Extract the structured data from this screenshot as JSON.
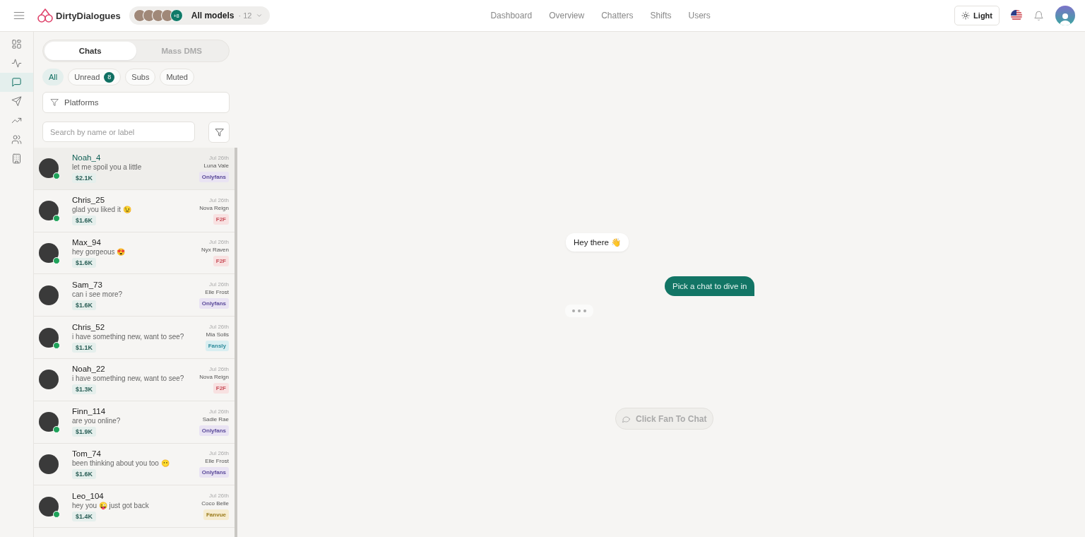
{
  "header": {
    "brand": "DirtyDialogues",
    "models": {
      "extra": "+8",
      "label": "All models",
      "count": "· 12"
    },
    "nav": [
      {
        "label": "Dashboard"
      },
      {
        "label": "Overview"
      },
      {
        "label": "Chatters"
      },
      {
        "label": "Shifts"
      },
      {
        "label": "Users"
      }
    ],
    "theme_button": "Light"
  },
  "sidebar": {
    "items": [
      {
        "kind": "grid",
        "selected": false
      },
      {
        "kind": "pulse",
        "selected": false
      },
      {
        "kind": "chat",
        "selected": true
      },
      {
        "kind": "send",
        "selected": false
      },
      {
        "kind": "trend",
        "selected": false
      },
      {
        "kind": "users",
        "selected": false
      },
      {
        "kind": "building",
        "selected": false
      }
    ]
  },
  "tabs": [
    {
      "label": "Chats",
      "selected": true
    },
    {
      "label": "Mass DMS",
      "selected": false
    }
  ],
  "filters": [
    {
      "label": "All",
      "selected": true
    },
    {
      "label": "Unread",
      "count": "8",
      "selected": false
    },
    {
      "label": "Subs",
      "selected": false
    },
    {
      "label": "Muted",
      "selected": false
    }
  ],
  "platforms": {
    "placeholder": "Platforms"
  },
  "search": {
    "placeholder": "Search by name or label"
  },
  "chats": [
    {
      "name": "Noah_4",
      "message": "let me spoil you a little",
      "amount": "$2.1K",
      "date": "Jul 26th",
      "model": "Luna Vale",
      "platform": "Onlyfans",
      "kind": "onlyfans",
      "online": true,
      "selected": true
    },
    {
      "name": "Chris_25",
      "message": "glad you liked it 😉",
      "amount": "$1.6K",
      "date": "Jul 26th",
      "model": "Nova Reign",
      "platform": "F2F",
      "kind": "f2f",
      "online": true,
      "selected": false
    },
    {
      "name": "Max_94",
      "message": "hey gorgeous 😍",
      "amount": "$1.6K",
      "date": "Jul 26th",
      "model": "Nyx Raven",
      "platform": "F2F",
      "kind": "f2f",
      "online": true,
      "selected": false
    },
    {
      "name": "Sam_73",
      "message": "can i see more?",
      "amount": "$1.6K",
      "date": "Jul 26th",
      "model": "Elle Frost",
      "platform": "Onlyfans",
      "kind": "onlyfans",
      "online": false,
      "selected": false
    },
    {
      "name": "Chris_52",
      "message": "i have something new, want to see?",
      "amount": "$1.1K",
      "date": "Jul 26th",
      "model": "Mia Solis",
      "platform": "Fansly",
      "kind": "fansly",
      "online": true,
      "selected": false
    },
    {
      "name": "Noah_22",
      "message": "i have something new, want to see?",
      "amount": "$1.3K",
      "date": "Jul 26th",
      "model": "Nova Reign",
      "platform": "F2F",
      "kind": "f2f",
      "online": false,
      "selected": false
    },
    {
      "name": "Finn_114",
      "message": "are you online?",
      "amount": "$1.9K",
      "date": "Jul 26th",
      "model": "Sadie Rae",
      "platform": "Onlyfans",
      "kind": "onlyfans",
      "online": true,
      "selected": false
    },
    {
      "name": "Tom_74",
      "message": "been thinking about you too 😶",
      "amount": "$1.6K",
      "date": "Jul 26th",
      "model": "Elle Frost",
      "platform": "Onlyfans",
      "kind": "onlyfans",
      "online": false,
      "selected": false
    },
    {
      "name": "Leo_104",
      "message": "hey you 😜 just got back",
      "amount": "$1.4K",
      "date": "Jul 26th",
      "model": "Coco Belle",
      "platform": "Fanvue",
      "kind": "fanvue",
      "online": true,
      "selected": false
    }
  ],
  "conversation": {
    "incoming": "Hey there 👋",
    "outgoing": "Pick a chat to dive in",
    "typing": true,
    "hint": "Click Fan To Chat"
  }
}
